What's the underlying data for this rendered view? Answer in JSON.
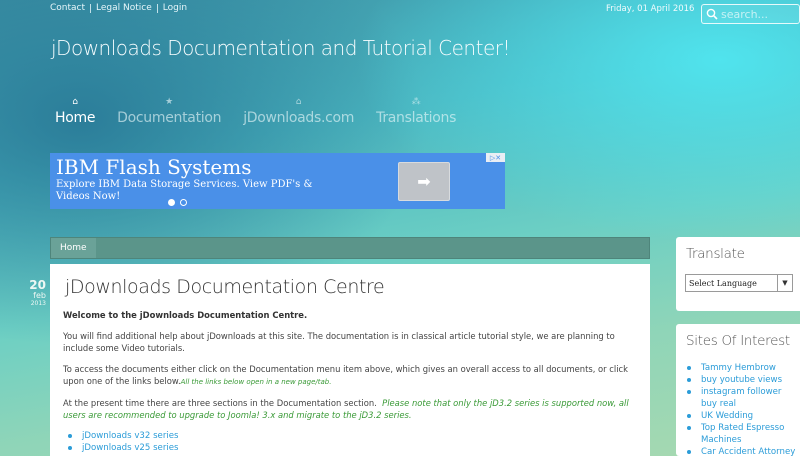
{
  "toplinks": [
    "Contact",
    "Legal Notice",
    "Login"
  ],
  "date": "Friday, 01 April 2016",
  "search": {
    "placeholder": "search..."
  },
  "site_title": "jDownloads Documentation and Tutorial Center!",
  "nav": [
    {
      "label": "Home",
      "icon": "home-icon",
      "glyph": "⌂",
      "active": true
    },
    {
      "label": "Documentation",
      "icon": "star-icon",
      "glyph": "★",
      "active": false
    },
    {
      "label": "jDownloads.com",
      "icon": "home-icon",
      "glyph": "⌂",
      "active": false
    },
    {
      "label": "Translations",
      "icon": "nodes-icon",
      "glyph": "⁂",
      "active": false
    }
  ],
  "ad": {
    "title": "IBM Flash Systems",
    "description": "Explore IBM Data Storage Services. View PDF's & Videos Now!",
    "button_glyph": "➡",
    "choice_glyph": "▷✕",
    "colors": {
      "background": "#4a90e8",
      "button": "#bfc3c8"
    }
  },
  "breadcrumb": {
    "home": "Home"
  },
  "article_date": {
    "day": "20",
    "month": "feb",
    "year": "2013"
  },
  "article": {
    "title": "jDownloads Documentation Centre",
    "welcome": "Welcome to the jDownloads Documentation Centre.",
    "para1": "You will find additional help about jDownloads at this site.  The documentation is in classical article tutorial style, we are planning to include some Video tutorials.",
    "para2": "To access the documents either click on the Documentation menu item above, which gives an overall access to all documents, or click upon one of the links below.",
    "para2_note": "All the links below open in a new page/tab.",
    "para3": "At the present time there are three sections in the Documentation section.",
    "para3_note": "Please note that only the jD3.2 series is supported now, all users are recommended to upgrade to Joomla! 3.x and migrate to the jD3.2 series.",
    "links": [
      "jDownloads v32 series",
      "jDownloads v25 series"
    ]
  },
  "translate": {
    "title": "Translate",
    "select_value": "Select Language"
  },
  "sites": {
    "title": "Sites Of Interest",
    "links": [
      "Tammy Hembrow",
      "buy youtube views",
      "instagram follower buy real",
      "UK Wedding",
      "Top Rated Espresso Machines",
      "Car Accident Attorney"
    ]
  },
  "colors": {
    "link": "#2b9cd8",
    "note": "#3a9a37",
    "breadcrumb_bar": "#5b958a"
  }
}
